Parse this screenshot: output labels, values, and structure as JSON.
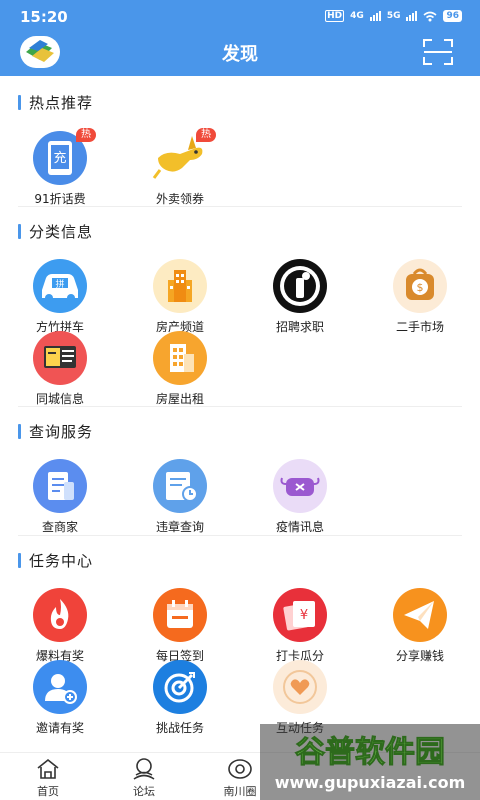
{
  "status_bar": {
    "time": "15:20",
    "network_a": "HD",
    "network_b": "4G",
    "network_c": "5G",
    "battery": "96"
  },
  "header": {
    "title": "发现"
  },
  "sections": {
    "hot": {
      "title": "热点推荐",
      "items": [
        {
          "label": "91折话费",
          "icon": "phone-recharge-icon",
          "badge": "热",
          "glyph": "充"
        },
        {
          "label": "外卖领券",
          "icon": "delivery-dog-icon",
          "badge": "热"
        }
      ]
    },
    "category": {
      "title": "分类信息",
      "items": [
        {
          "label": "方竹拼车",
          "icon": "carpool-icon",
          "glyph": "拼"
        },
        {
          "label": "房产频道",
          "icon": "building-icon"
        },
        {
          "label": "招聘求职",
          "icon": "job-icon"
        },
        {
          "label": "二手市场",
          "icon": "secondhand-bag-icon",
          "glyph": "$"
        },
        {
          "label": "同城信息",
          "icon": "local-info-icon"
        },
        {
          "label": "房屋出租",
          "icon": "house-rent-icon"
        }
      ]
    },
    "query": {
      "title": "查询服务",
      "items": [
        {
          "label": "查商家",
          "icon": "merchant-icon"
        },
        {
          "label": "违章查询",
          "icon": "violation-icon"
        },
        {
          "label": "疫情讯息",
          "icon": "epidemic-icon"
        }
      ]
    },
    "tasks": {
      "title": "任务中心",
      "items": [
        {
          "label": "爆料有奖",
          "icon": "flame-icon"
        },
        {
          "label": "每日签到",
          "icon": "calendar-icon"
        },
        {
          "label": "打卡瓜分",
          "icon": "money-cards-icon",
          "glyph": "¥"
        },
        {
          "label": "分享赚钱",
          "icon": "paper-plane-icon"
        },
        {
          "label": "邀请有奖",
          "icon": "invite-user-icon"
        },
        {
          "label": "挑战任务",
          "icon": "target-icon"
        },
        {
          "label": "互动任务",
          "icon": "heart-icon"
        }
      ]
    }
  },
  "bottom_nav": [
    {
      "label": "首页",
      "icon": "home-icon"
    },
    {
      "label": "论坛",
      "icon": "forum-icon"
    },
    {
      "label": "南川圈",
      "icon": "circle-icon"
    }
  ],
  "watermark": {
    "line1": "谷普软件园",
    "line2": "www.gupuxiazai.com"
  },
  "colors": {
    "primary": "#4a96ea",
    "badge": "#f04a3a"
  }
}
